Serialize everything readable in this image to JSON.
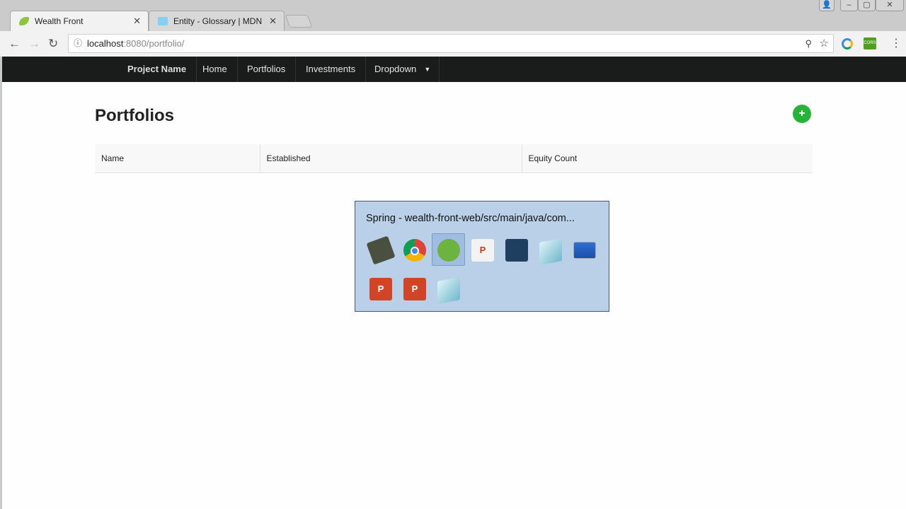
{
  "browser": {
    "tabs": [
      {
        "label": "Wealth Front",
        "icon": "spring-leaf-icon",
        "active": true
      },
      {
        "label": "Entity - Glossary | MDN",
        "icon": "mdn-dino-icon",
        "active": false
      }
    ],
    "close_glyph": "✕",
    "url_host": "localhost",
    "url_path": ":8080/portfolio/",
    "extensions": [
      "chrome-extension-icon",
      "cors-extension-icon"
    ],
    "cors_label": "CORS"
  },
  "navbar": {
    "brand": "Project Name",
    "items": [
      "Home",
      "Portfolios",
      "Investments",
      "Dropdown"
    ]
  },
  "main": {
    "title": "Portfolios",
    "add_label": "+",
    "table": {
      "headers": [
        "Name",
        "Established",
        "Equity Count"
      ],
      "rows": []
    }
  },
  "switcher": {
    "title": "Spring - wealth-front-web/src/main/java/com...",
    "apps": [
      "virtualbox-icon",
      "chrome-icon",
      "spring-icon",
      "powerpoint-doc-icon",
      "mysql-workbench-icon",
      "notepad-icon",
      "remote-desktop-icon",
      "powerpoint-icon",
      "powerpoint-show-icon",
      "notepad-icon"
    ],
    "selected": "spring-icon",
    "ppt_letter": "P"
  }
}
